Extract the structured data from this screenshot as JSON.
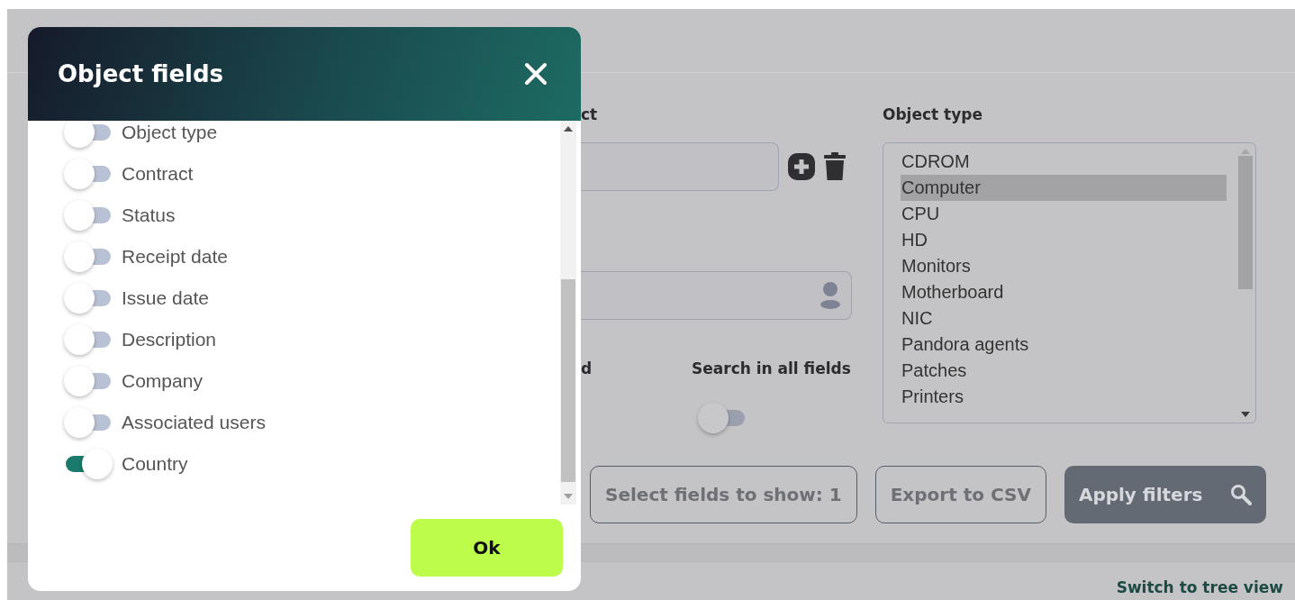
{
  "background": {
    "object_label": "ct",
    "user_label": "d",
    "search_all": {
      "label": "Search in all fields",
      "on": false
    },
    "object_type": {
      "label": "Object type",
      "options": [
        {
          "label": "CDROM",
          "selected": false
        },
        {
          "label": "Computer",
          "selected": true
        },
        {
          "label": "CPU",
          "selected": false
        },
        {
          "label": "HD",
          "selected": false
        },
        {
          "label": "Monitors",
          "selected": false
        },
        {
          "label": "Motherboard",
          "selected": false
        },
        {
          "label": "NIC",
          "selected": false
        },
        {
          "label": "Pandora agents",
          "selected": false
        },
        {
          "label": "Patches",
          "selected": false
        },
        {
          "label": "Printers",
          "selected": false
        }
      ]
    },
    "buttons": [
      {
        "label": "Select fields to show: 1",
        "kind": "outline"
      },
      {
        "label": "Export to CSV",
        "kind": "outline"
      },
      {
        "label": "Apply filters",
        "kind": "search"
      }
    ],
    "switch_link": "Switch to tree view"
  },
  "dialog": {
    "title": "Object fields",
    "fields": [
      {
        "label": "Object type",
        "on": false
      },
      {
        "label": "Contract",
        "on": false
      },
      {
        "label": "Status",
        "on": false
      },
      {
        "label": "Receipt date",
        "on": false
      },
      {
        "label": "Issue date",
        "on": false
      },
      {
        "label": "Description",
        "on": false
      },
      {
        "label": "Company",
        "on": false
      },
      {
        "label": "Associated users",
        "on": false
      },
      {
        "label": "Country",
        "on": true
      }
    ],
    "ok_button": "Ok"
  }
}
